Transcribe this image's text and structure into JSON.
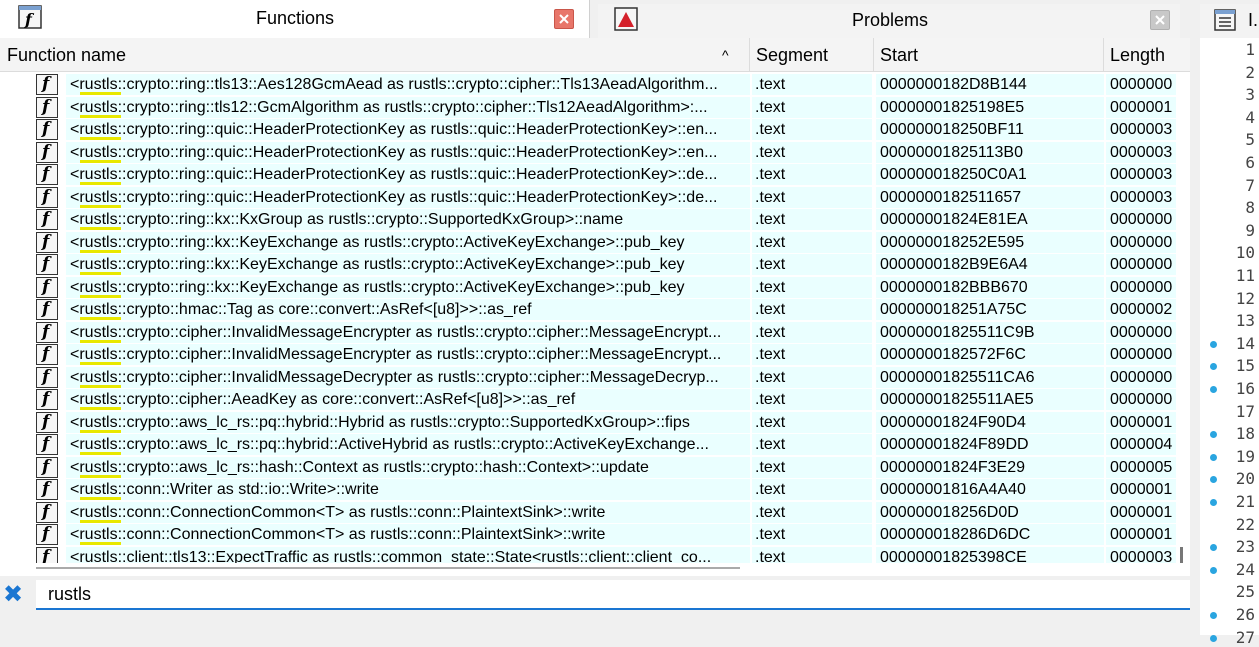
{
  "tabs": [
    {
      "label": "Functions"
    },
    {
      "label": "Problems"
    },
    {
      "label": "I."
    }
  ],
  "columns": {
    "name": "Function name",
    "segment": "Segment",
    "start": "Start",
    "length": "Length"
  },
  "sort_indicator": "^",
  "rows": [
    {
      "name": "<rustls::crypto::ring::tls13::Aes128GcmAead as rustls::crypto::cipher::Tls13AeadAlgorithm...",
      "segment": ".text",
      "start": "0000000182D8B144",
      "length": "0000000"
    },
    {
      "name": "<rustls::crypto::ring::tls12::GcmAlgorithm as rustls::crypto::cipher::Tls12AeadAlgorithm>:...",
      "segment": ".text",
      "start": "00000001825198E5",
      "length": "0000001"
    },
    {
      "name": "<rustls::crypto::ring::quic::HeaderProtectionKey as rustls::quic::HeaderProtectionKey>::en...",
      "segment": ".text",
      "start": "000000018250BF11",
      "length": "0000003"
    },
    {
      "name": "<rustls::crypto::ring::quic::HeaderProtectionKey as rustls::quic::HeaderProtectionKey>::en...",
      "segment": ".text",
      "start": "00000001825113B0",
      "length": "0000003"
    },
    {
      "name": "<rustls::crypto::ring::quic::HeaderProtectionKey as rustls::quic::HeaderProtectionKey>::de...",
      "segment": ".text",
      "start": "000000018250C0A1",
      "length": "0000003"
    },
    {
      "name": "<rustls::crypto::ring::quic::HeaderProtectionKey as rustls::quic::HeaderProtectionKey>::de...",
      "segment": ".text",
      "start": "0000000182511657",
      "length": "0000003"
    },
    {
      "name": "<rustls::crypto::ring::kx::KxGroup as rustls::crypto::SupportedKxGroup>::name",
      "segment": ".text",
      "start": "00000001824E81EA",
      "length": "0000000"
    },
    {
      "name": "<rustls::crypto::ring::kx::KeyExchange as rustls::crypto::ActiveKeyExchange>::pub_key",
      "segment": ".text",
      "start": "000000018252E595",
      "length": "0000000"
    },
    {
      "name": "<rustls::crypto::ring::kx::KeyExchange as rustls::crypto::ActiveKeyExchange>::pub_key",
      "segment": ".text",
      "start": "0000000182B9E6A4",
      "length": "0000000"
    },
    {
      "name": "<rustls::crypto::ring::kx::KeyExchange as rustls::crypto::ActiveKeyExchange>::pub_key",
      "segment": ".text",
      "start": "0000000182BBB670",
      "length": "0000000"
    },
    {
      "name": "<rustls::crypto::hmac::Tag as core::convert::AsRef<[u8]>>::as_ref",
      "segment": ".text",
      "start": "000000018251A75C",
      "length": "0000002"
    },
    {
      "name": "<rustls::crypto::cipher::InvalidMessageEncrypter as rustls::crypto::cipher::MessageEncrypt...",
      "segment": ".text",
      "start": "00000001825511C9B",
      "length": "0000000"
    },
    {
      "name": "<rustls::crypto::cipher::InvalidMessageEncrypter as rustls::crypto::cipher::MessageEncrypt...",
      "segment": ".text",
      "start": "0000000182572F6C",
      "length": "0000000"
    },
    {
      "name": "<rustls::crypto::cipher::InvalidMessageDecrypter as rustls::crypto::cipher::MessageDecryp...",
      "segment": ".text",
      "start": "00000001825511CA6",
      "length": "0000000"
    },
    {
      "name": "<rustls::crypto::cipher::AeadKey as core::convert::AsRef<[u8]>>::as_ref",
      "segment": ".text",
      "start": "00000001825511AE5",
      "length": "0000000"
    },
    {
      "name": "<rustls::crypto::aws_lc_rs::pq::hybrid::Hybrid as rustls::crypto::SupportedKxGroup>::fips",
      "segment": ".text",
      "start": "00000001824F90D4",
      "length": "0000001"
    },
    {
      "name": "<rustls::crypto::aws_lc_rs::pq::hybrid::ActiveHybrid as rustls::crypto::ActiveKeyExchange...",
      "segment": ".text",
      "start": "00000001824F89DD",
      "length": "0000004"
    },
    {
      "name": "<rustls::crypto::aws_lc_rs::hash::Context as rustls::crypto::hash::Context>::update",
      "segment": ".text",
      "start": "00000001824F3E29",
      "length": "0000005"
    },
    {
      "name": "<rustls::conn::Writer as std::io::Write>::write",
      "segment": ".text",
      "start": "00000001816A4A40",
      "length": "0000001"
    },
    {
      "name": "<rustls::conn::ConnectionCommon<T> as rustls::conn::PlaintextSink>::write",
      "segment": ".text",
      "start": "000000018256D0D",
      "length": "0000001"
    },
    {
      "name": "<rustls::conn::ConnectionCommon<T> as rustls::conn::PlaintextSink>::write",
      "segment": ".text",
      "start": "000000018286D6DC",
      "length": "0000001"
    },
    {
      "name": "<rustls::client::tls13::ExpectTraffic as rustls::common_state::State<rustls::client::client_co...",
      "segment": ".text",
      "start": "00000001825398CE",
      "length": "0000003"
    }
  ],
  "filter": {
    "value": "rustls"
  },
  "line_numbers": [
    "1",
    "2",
    "3",
    "4",
    "5",
    "6",
    "7",
    "8",
    "9",
    "10",
    "11",
    "12",
    "13",
    "14",
    "15",
    "16",
    "17",
    "18",
    "19",
    "20",
    "21",
    "22",
    "23",
    "24",
    "25",
    "26",
    "27"
  ],
  "dotted_lines": [
    14,
    15,
    16,
    18,
    19,
    20,
    21,
    23,
    24,
    26,
    27
  ],
  "colors": {
    "accent": "#1a76d2",
    "row_band": "#eaffff",
    "highlight": "#e8e800",
    "dot": "#2aa5e0"
  }
}
